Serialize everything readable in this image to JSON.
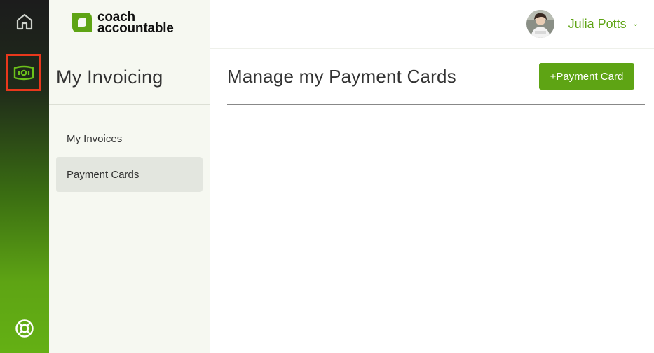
{
  "rail": {
    "items": [
      {
        "name": "home-icon"
      },
      {
        "name": "invoicing-icon",
        "active": true
      },
      {
        "name": "help-lifebuoy-icon"
      }
    ],
    "highlight_color": "#e8381c"
  },
  "brand": {
    "line1": "coach",
    "line2": "accountable",
    "logo_icon": "leaf-logo-icon",
    "color": "#5ea414"
  },
  "sidebar": {
    "title": "My Invoicing",
    "items": [
      {
        "label": "My Invoices",
        "active": false
      },
      {
        "label": "Payment Cards",
        "active": true
      }
    ]
  },
  "header": {
    "user_name": "Julia Potts",
    "caret": "⌄"
  },
  "main": {
    "title": "Manage my Payment Cards",
    "add_button_label": "+Payment Card"
  },
  "colors": {
    "accent": "#5ea414",
    "rail_dark": "#1c1c1c",
    "sidebar_bg": "#f6f8f1",
    "active_item_bg": "#e3e6df"
  }
}
